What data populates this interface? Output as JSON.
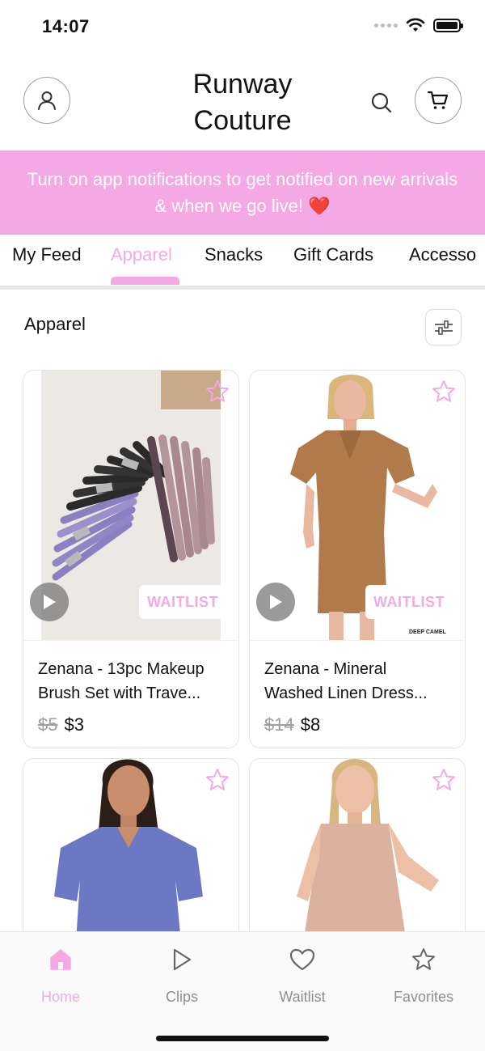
{
  "status_bar": {
    "time": "14:07"
  },
  "header": {
    "title": "Runway Couture"
  },
  "banner": {
    "text": "Turn on app notifications to get notified on new arrivals & when we go live! ❤️"
  },
  "tabs": [
    {
      "label": "My Feed",
      "active": false
    },
    {
      "label": "Apparel",
      "active": true
    },
    {
      "label": "Snacks",
      "active": false
    },
    {
      "label": "Gift Cards",
      "active": false
    },
    {
      "label": "Accesso",
      "active": false
    }
  ],
  "section": {
    "title": "Apparel"
  },
  "products": [
    {
      "name_line1": "Zenana - 13pc Makeup",
      "name_line2": "Brush Set with Trave...",
      "old_price": "$5",
      "price": "$3",
      "badge": "WAITLIST",
      "has_video": true,
      "image": "makeup-brush-set-photo"
    },
    {
      "name_line1": "Zenana - Mineral",
      "name_line2": "Washed Linen Dress...",
      "old_price": "$14",
      "price": "$8",
      "badge": "WAITLIST",
      "has_video": true,
      "image": "brown-linen-dress-photo",
      "image_caption": "DEEP CAMEL"
    },
    {
      "image": "blue-blouse-photo"
    },
    {
      "image": "beige-tank-dress-photo"
    }
  ],
  "bottom_nav": [
    {
      "label": "Home",
      "icon": "home-icon",
      "active": true
    },
    {
      "label": "Clips",
      "icon": "play-icon",
      "active": false
    },
    {
      "label": "Waitlist",
      "icon": "heart-icon",
      "active": false
    },
    {
      "label": "Favorites",
      "icon": "star-icon",
      "active": false
    }
  ],
  "colors": {
    "accent_pink": "#f4a9e4",
    "text": "#111111",
    "muted": "#8e8e8e"
  }
}
